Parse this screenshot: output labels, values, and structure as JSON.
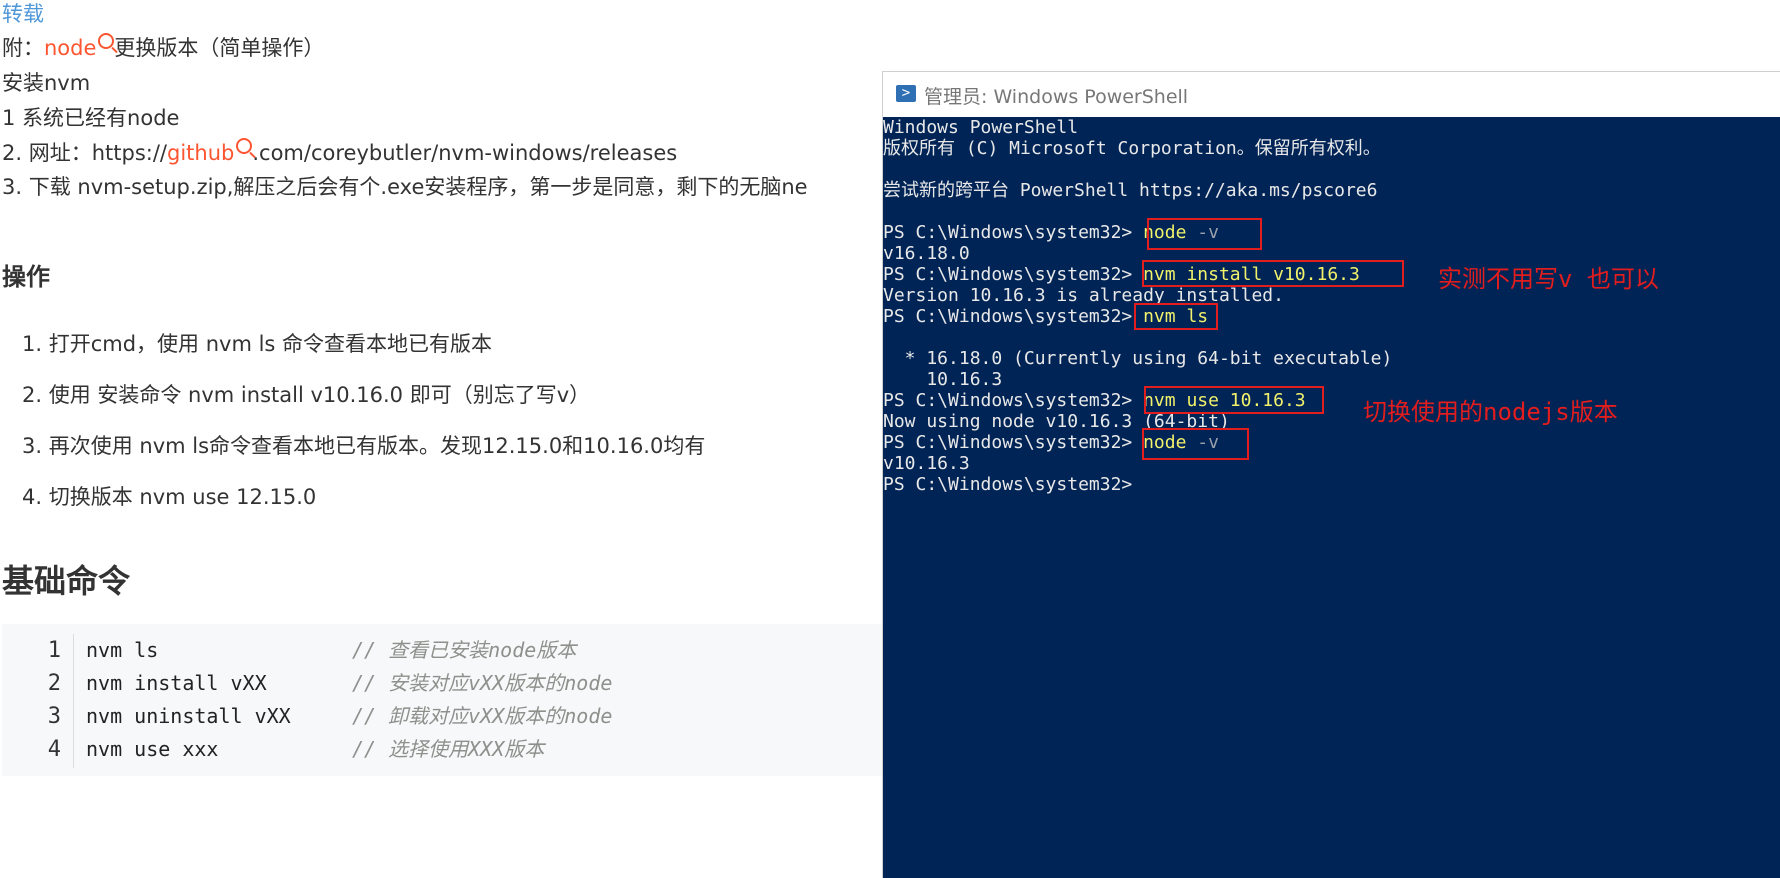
{
  "article": {
    "reprint_label": "转载",
    "attach_prefix": "附：",
    "attach_keyword": "node",
    "attach_suffix": "更换版本（简单操作）",
    "install_nvm": "安装nvm",
    "line1": "1 系统已经有node",
    "line2_prefix": "2. 网址：https://",
    "line2_keyword": "github",
    "line2_suffix": ".com/coreybutler/nvm-windows/releases",
    "line3": "3. 下载 nvm-setup.zip,解压之后会有个.exe安装程序，第一步是同意，剩下的无脑ne",
    "heading_ops": "操作",
    "steps": [
      "1. 打开cmd，使用 nvm ls 命令查看本地已有版本",
      "2. 使用 安装命令 nvm install v10.16.0 即可（别忘了写v）",
      "3. 再次使用 nvm ls命令查看本地已有版本。发现12.15.0和10.16.0均有",
      "4. 切换版本 nvm use 12.15.0"
    ],
    "heading_basic": "基础命令",
    "code": [
      {
        "num": "1",
        "cmd": "nvm ls",
        "comment": "// 查看已安装node版本"
      },
      {
        "num": "2",
        "cmd": "nvm install vXX",
        "comment": "// 安装对应vXX版本的node"
      },
      {
        "num": "3",
        "cmd": "nvm uninstall vXX",
        "comment": "// 卸载对应vXX版本的node"
      },
      {
        "num": "4",
        "cmd": "nvm use xxx",
        "comment": "// 选择使用XXX版本"
      }
    ]
  },
  "powershell": {
    "title": "管理员: Windows PowerShell",
    "icon": "powershell-icon",
    "lines": {
      "l0": "Windows PowerShell",
      "l1": "版权所有 (C) Microsoft Corporation。保留所有权利。",
      "l3": "尝试新的跨平台 PowerShell https://aka.ms/pscore6",
      "prompt": "PS C:\\Windows\\system32> ",
      "cmd1_a": "node",
      "cmd1_b": " -v",
      "out1": "v16.18.0",
      "cmd2": "nvm install v10.16.3",
      "out2": "Version 10.16.3 is already installed.",
      "cmd3": "nvm ls",
      "out3a": "  * 16.18.0 (Currently using 64-bit executable)",
      "out3b": "    10.16.3",
      "cmd4": "nvm use 10.16.3",
      "out4": "Now using node v10.16.3 (64-bit)",
      "cmd5_a": "node",
      "cmd5_b": " -v",
      "out5": "v10.16.3",
      "last_prompt": "PS C:\\Windows\\system32>"
    },
    "annotations": {
      "note1": "实测不用写v 也可以",
      "note2": "切换使用的nodejs版本"
    },
    "colors": {
      "background": "#012456",
      "highlight_box": "#e21d1d"
    }
  }
}
